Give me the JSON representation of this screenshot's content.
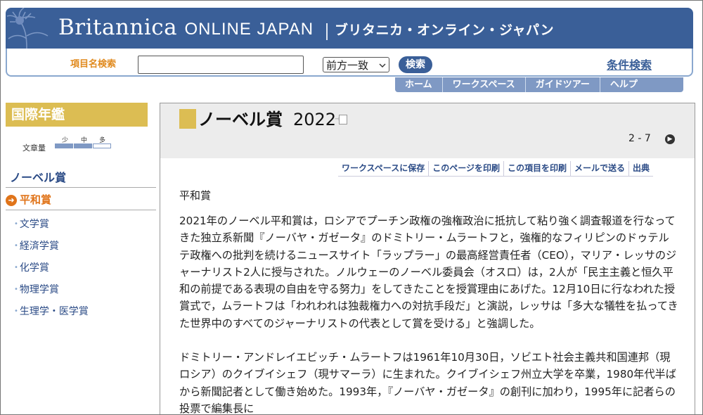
{
  "header": {
    "brand_name": "Britannica",
    "brand_suffix": "ONLINE JAPAN",
    "brand_jp": "ブリタニカ・オンライン・ジャパン"
  },
  "search": {
    "label": "項目名検索",
    "value": "",
    "placeholder": "",
    "match_mode": "前方一致",
    "button_label": "検索",
    "advanced_label": "条件検索"
  },
  "nav": {
    "items": [
      "ホーム",
      "ワークスペース",
      "ガイドツアー",
      "ヘルプ"
    ]
  },
  "sidebar": {
    "section_title": "国際年鑑",
    "text_length_label": "文章量",
    "text_length_levels": [
      "少",
      "中",
      "多"
    ],
    "text_length_selected": "中",
    "category": "ノーベル賞",
    "active_item": "平和賞",
    "items": [
      "文学賞",
      "経済学賞",
      "化学賞",
      "物理学賞",
      "生理学・医学賞"
    ]
  },
  "article": {
    "title": "ノーベル賞",
    "year": "2022",
    "pager": "2 - 7",
    "actions": [
      "ワークスペースに保存",
      "このページを印刷",
      "この項目を印刷",
      "メールで送る",
      "出典"
    ],
    "subheading": "平和賞",
    "paragraphs": [
      "2021年のノーベル平和賞は，ロシアでプーチン政権の強権政治に抵抗して粘り強く調査報道を行なってきた独立系新聞『ノーバヤ・ガゼータ』のドミトリー・ムラートフと，強権的なフィリピンのドゥテルテ政権への批判を続けるニュースサイト「ラップラー」の最高経営責任者（CEO），マリア・レッサのジャーナリスト2人に授与された。ノルウェーのノーベル委員会（オスロ）は，2人が「民主主義と恒久平和の前提である表現の自由を守る努力」をしてきたことを授賞理由にあげた。12月10日に行なわれた授賞式で，ムラートフは「われわれは独裁権力への対抗手段だ」と演説，レッサは「多大な犠牲を払ってきた世界中のすべてのジャーナリストの代表として賞を受ける」と強調した。",
      "ドミトリー・アンドレイエビッチ・ムラートフは1961年10月30日，ソビエト社会主義共和国連邦（現ロシア）のクイブイシェフ（現サマーラ）に生まれた。クイブイシェフ州立大学を卒業，1980年代半ばから新聞記者として働き始めた。1993年，『ノーバヤ・ガゼータ』の創刊に加わり，1995年に記者らの投票で編集長に"
    ]
  }
}
